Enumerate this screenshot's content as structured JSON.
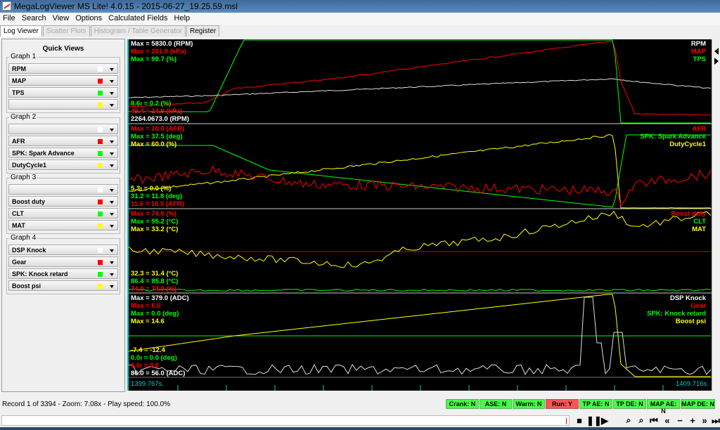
{
  "window": {
    "title": "MegaLogViewer MS Lite! 4.0.15 - 2015-06-27_19.25.59.msl"
  },
  "menu": [
    "File",
    "Search",
    "View",
    "Options",
    "Calculated Fields",
    "Help"
  ],
  "tabs": [
    {
      "label": "Log Viewer",
      "state": "active"
    },
    {
      "label": "Scatter Plots",
      "state": "disabled"
    },
    {
      "label": "Histogram / Table Generator",
      "state": "disabled"
    },
    {
      "label": "Register",
      "state": "normal"
    }
  ],
  "quick_views": {
    "title": "Quick Views",
    "graphs": [
      {
        "label": "Graph 1",
        "fields": [
          {
            "name": "RPM",
            "color": "#ffffff"
          },
          {
            "name": "MAP",
            "color": "#ff0000"
          },
          {
            "name": "TPS",
            "color": "#00ff00"
          },
          {
            "name": "",
            "color": "#ffff00"
          }
        ]
      },
      {
        "label": "Graph 2",
        "fields": [
          {
            "name": "",
            "color": "#ffffff"
          },
          {
            "name": "AFR",
            "color": "#ff0000"
          },
          {
            "name": "SPK: Spark Advance",
            "color": "#00ff00"
          },
          {
            "name": "DutyCycle1",
            "color": "#ffff00"
          }
        ]
      },
      {
        "label": "Graph 3",
        "fields": [
          {
            "name": "",
            "color": "#ffffff"
          },
          {
            "name": "Boost duty",
            "color": "#ff0000"
          },
          {
            "name": "CLT",
            "color": "#00ff00"
          },
          {
            "name": "MAT",
            "color": "#ffff00"
          }
        ]
      },
      {
        "label": "Graph 4",
        "fields": [
          {
            "name": "DSP Knock",
            "color": "#ffffff"
          },
          {
            "name": "Gear",
            "color": "#ff0000"
          },
          {
            "name": "SPK: Knock retard",
            "color": "#00ff00"
          },
          {
            "name": "Boost psi",
            "color": "#ffff00"
          }
        ]
      }
    ]
  },
  "panels": [
    {
      "max": [
        {
          "t": "Max = 5830.0 (RPM)",
          "c": "#ffffff"
        },
        {
          "t": "Max = 201.0 (kPa)",
          "c": "#ff0000"
        },
        {
          "t": "Max = 99.7 (%)",
          "c": "#00ff00"
        }
      ],
      "min": [
        {
          "t": "8.6ı = 0.2 (%)",
          "c": "#00ff00"
        },
        {
          "t": "49.4 = 14.9 (kPa)",
          "c": "#ff0000"
        },
        {
          "t": "2264.0673.0 (RPM)",
          "c": "#ffffff"
        }
      ],
      "names": [
        {
          "t": "RPM",
          "c": "#ffffff"
        },
        {
          "t": "MAP",
          "c": "#ff0000"
        },
        {
          "t": "TPS",
          "c": "#00ff00"
        }
      ]
    },
    {
      "max": [
        {
          "t": "Max = 20.0 (AFR)",
          "c": "#ff0000"
        },
        {
          "t": "Max = 37.5 (deg)",
          "c": "#00ff00"
        },
        {
          "t": "Max = 60.0 (%)",
          "c": "#ffff00"
        }
      ],
      "min": [
        {
          "t": "5.3ı = 0.0 (%)",
          "c": "#ffff00"
        },
        {
          "t": "31.2 = 11.8 (deg)",
          "c": "#00ff00"
        },
        {
          "t": "11.6 = 10.0 (AFR)",
          "c": "#ff0000"
        }
      ],
      "names": [
        {
          "t": "AFR",
          "c": "#ff0000"
        },
        {
          "t": "SPK: Spark Advance",
          "c": "#00ff00"
        },
        {
          "t": "DutyCycle1",
          "c": "#ffff00"
        }
      ]
    },
    {
      "max": [
        {
          "t": "Max = 74.0 (%)",
          "c": "#ff0000"
        },
        {
          "t": "Max = 95.2 (°C)",
          "c": "#00ff00"
        },
        {
          "t": "Max = 33.2 (°C)",
          "c": "#ffff00"
        }
      ],
      "min": [
        {
          "t": "32.3 = 31.4 (°C)",
          "c": "#ffff00"
        },
        {
          "t": "86.4 = 85.8 (°C)",
          "c": "#00ff00"
        },
        {
          "t": "74.0 = 74.0 (%)",
          "c": "#ff0000"
        }
      ],
      "names": [
        {
          "t": "Boost duty",
          "c": "#ff0000"
        },
        {
          "t": "CLT",
          "c": "#00ff00"
        },
        {
          "t": "MAT",
          "c": "#ffff00"
        }
      ]
    },
    {
      "max": [
        {
          "t": "Max = 379.0 (ADC)",
          "c": "#ffffff"
        },
        {
          "t": "Max = 6.0",
          "c": "#ff0000"
        },
        {
          "t": "Max = 0.0 (deg)",
          "c": "#00ff00"
        },
        {
          "t": "Max = 14.6",
          "c": "#ffff00"
        }
      ],
      "min": [
        {
          "t": "-7.4 = -12.4",
          "c": "#ffff00"
        },
        {
          "t": "0.0ı = 0.0 (deg)",
          "c": "#00ff00"
        },
        {
          "t": "6.0ı = 0.0",
          "c": "#ff0000"
        },
        {
          "t": "86.0 = 56.0 (ADC)",
          "c": "#ffffff"
        }
      ],
      "names": [
        {
          "t": "DSP Knock",
          "c": "#ffffff"
        },
        {
          "t": "Gear",
          "c": "#ff0000"
        },
        {
          "t": "SPK: Knock retard",
          "c": "#00ff00"
        },
        {
          "t": "Boost psi",
          "c": "#ffff00"
        }
      ]
    }
  ],
  "time_axis": {
    "start": "1399.767s.",
    "end": "1409.716s."
  },
  "status": {
    "record": "Record 1 of 3394 - Zoom: 7.08x - Play speed: 100.0%",
    "flags": [
      {
        "label": "Crank: N",
        "on": false
      },
      {
        "label": "ASE: N",
        "on": false
      },
      {
        "label": "Warm: N",
        "on": false
      },
      {
        "label": "Run: Y",
        "on": true
      },
      {
        "label": "TP AE: N",
        "on": false
      },
      {
        "label": "TP DE: N",
        "on": false
      },
      {
        "label": "MAP AE: N",
        "on": false
      },
      {
        "label": "MAP DE: N",
        "on": false
      }
    ]
  },
  "playback": {
    "position": 0.995
  }
}
